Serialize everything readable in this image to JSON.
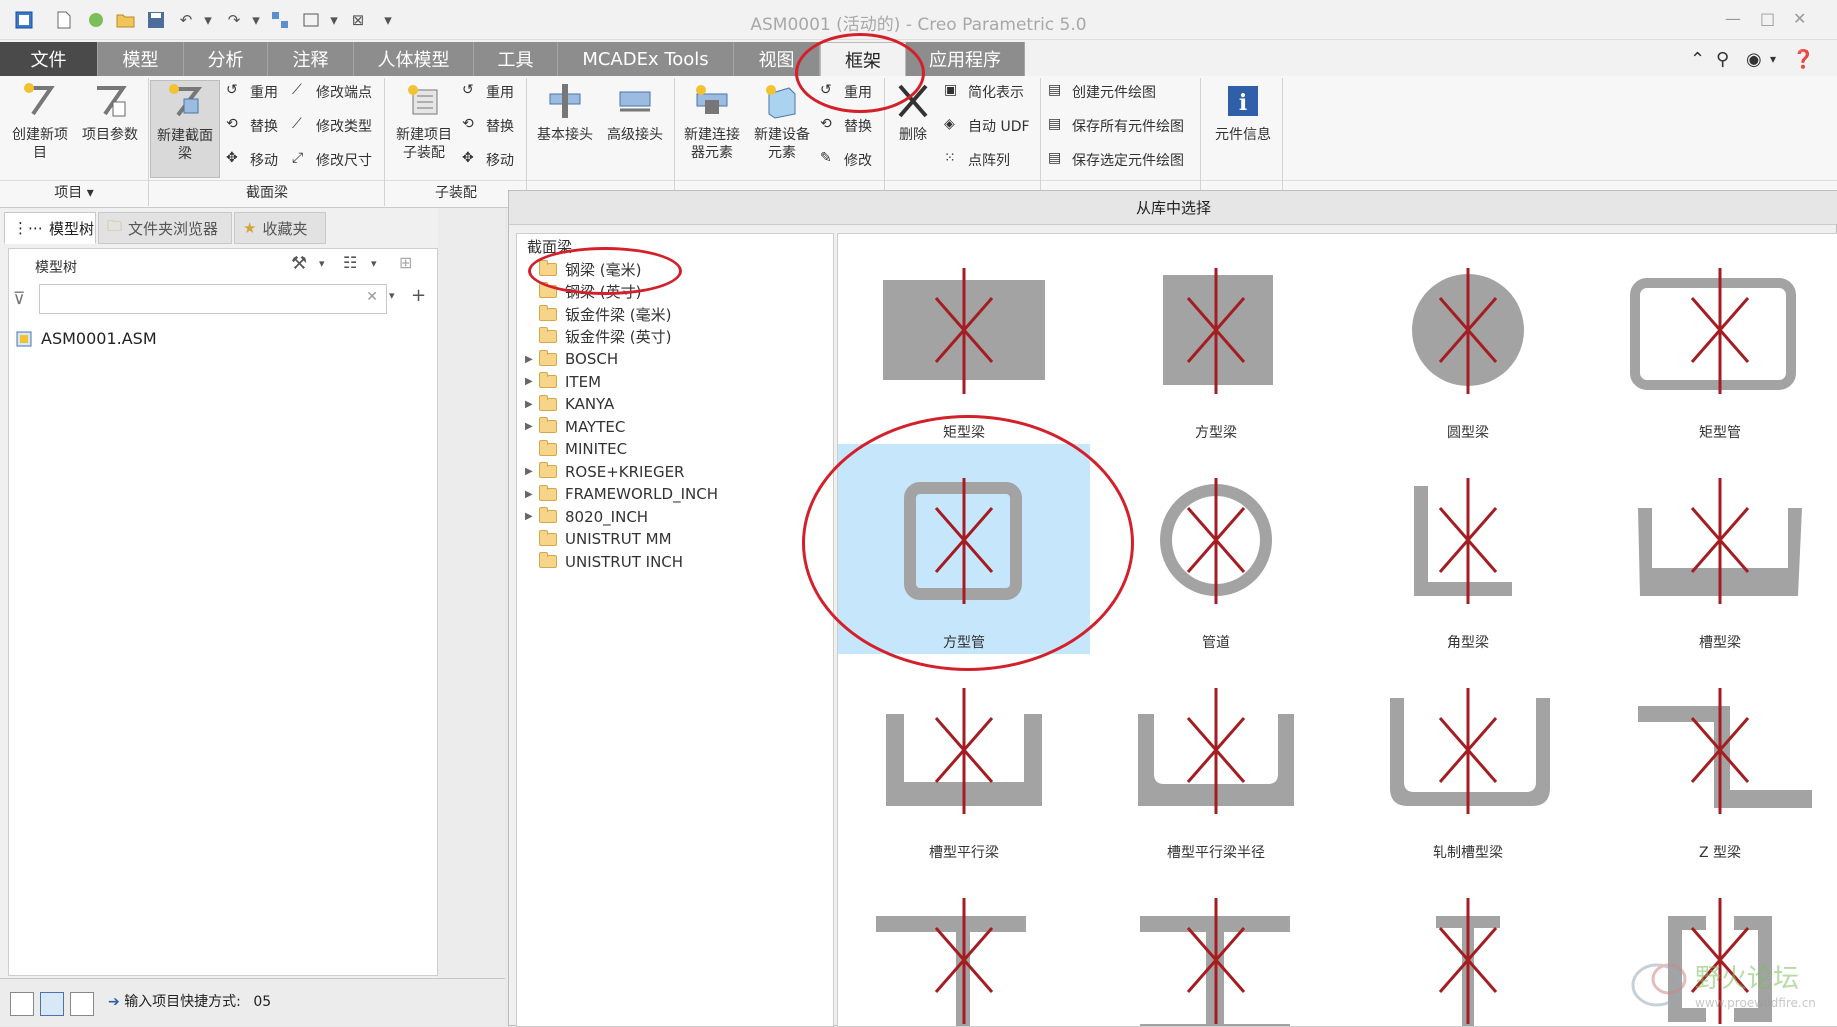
{
  "window": {
    "title": "ASM0001 (活动的) - Creo Parametric 5.0"
  },
  "tabs": [
    {
      "label": "文件"
    },
    {
      "label": "模型"
    },
    {
      "label": "分析"
    },
    {
      "label": "注释"
    },
    {
      "label": "人体模型"
    },
    {
      "label": "工具"
    },
    {
      "label": "MCADEx Tools"
    },
    {
      "label": "视图"
    },
    {
      "label": "框架"
    },
    {
      "label": "应用程序"
    }
  ],
  "ribbon": {
    "create_item": "创建新项目",
    "item_params": "项目参数",
    "new_section_beam": "新建截面梁",
    "beam_small": [
      "重用",
      "替换",
      "移动"
    ],
    "beam_modify": [
      "修改端点",
      "修改类型",
      "修改尺寸"
    ],
    "new_subassembly": "新建项目子装配",
    "sub_small": [
      "重用",
      "替换",
      "移动"
    ],
    "basic_joint": "基本接头",
    "advanced_joint": "高级接头",
    "new_connector": "新建连接器元素",
    "new_equipment": "新建设备元素",
    "equip_small": [
      "重用",
      "替换",
      "修改"
    ],
    "delete": "删除",
    "simplify": [
      "简化表示",
      "自动 UDF",
      "点阵列"
    ],
    "drawing": [
      "创建元件绘图",
      "保存所有元件绘图",
      "保存选定元件绘图"
    ],
    "component_info": "元件信息",
    "group_labels": [
      "项目",
      "截面梁",
      "子装配"
    ]
  },
  "left_panel": {
    "tabs": [
      "模型树",
      "文件夹浏览器",
      "收藏夹"
    ],
    "tree_header": "模型树",
    "root_node": "ASM0001.ASM",
    "filter_placeholder": ""
  },
  "status": {
    "text": "输入项目快捷方式:",
    "value": "05"
  },
  "dialog": {
    "title": "从库中选择",
    "tree_root": "截面梁",
    "tree_items": [
      {
        "label": "钢梁 (毫米)",
        "expandable": false,
        "open": true
      },
      {
        "label": "钢梁 (英寸)",
        "expandable": false
      },
      {
        "label": "钣金件梁 (毫米)",
        "expandable": false
      },
      {
        "label": "钣金件梁 (英寸)",
        "expandable": false
      },
      {
        "label": "BOSCH",
        "expandable": true
      },
      {
        "label": "ITEM",
        "expandable": true
      },
      {
        "label": "KANYA",
        "expandable": true
      },
      {
        "label": "MAYTEC",
        "expandable": true
      },
      {
        "label": "MINITEC",
        "expandable": false
      },
      {
        "label": "ROSE+KRIEGER",
        "expandable": true
      },
      {
        "label": "FRAMEWORLD_INCH",
        "expandable": true
      },
      {
        "label": "8020_INCH",
        "expandable": true
      },
      {
        "label": "UNISTRUT MM",
        "expandable": false
      },
      {
        "label": "UNISTRUT INCH",
        "expandable": false
      }
    ],
    "profiles": [
      {
        "label": "矩型梁",
        "shape": "rect-solid"
      },
      {
        "label": "方型梁",
        "shape": "square-solid"
      },
      {
        "label": "圆型梁",
        "shape": "circle-solid"
      },
      {
        "label": "矩型管",
        "shape": "rect-tube"
      },
      {
        "label": "方型管",
        "shape": "square-tube",
        "selected": true
      },
      {
        "label": "管道",
        "shape": "pipe"
      },
      {
        "label": "角型梁",
        "shape": "angle"
      },
      {
        "label": "槽型梁",
        "shape": "channel"
      },
      {
        "label": "槽型平行梁",
        "shape": "channel-parallel"
      },
      {
        "label": "槽型平行梁半径",
        "shape": "channel-parallel-radius"
      },
      {
        "label": "轧制槽型梁",
        "shape": "rolled-channel"
      },
      {
        "label": "Z 型梁",
        "shape": "z-beam"
      },
      {
        "label": "",
        "shape": "t-beam"
      },
      {
        "label": "",
        "shape": "i-beam"
      },
      {
        "label": "",
        "shape": "i-beam-narrow"
      },
      {
        "label": "",
        "shape": "c-rail"
      }
    ]
  },
  "colors": {
    "profile_gray": "#a3a3a3",
    "axis_red": "#a31d22",
    "selection_blue": "#c6e6fb",
    "annotation_red": "#d3202a"
  },
  "watermark": {
    "text": "野火论坛",
    "url": "www.proewildfire.cn"
  }
}
